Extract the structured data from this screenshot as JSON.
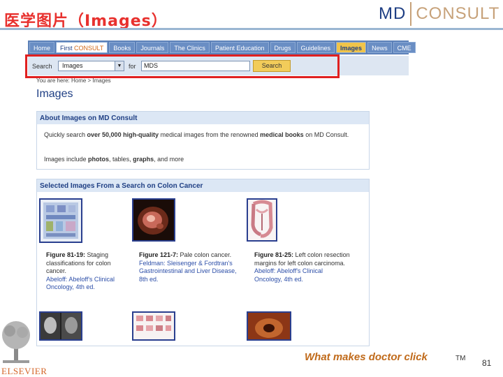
{
  "slide": {
    "title": "医学图片（Images）",
    "page_number": "81",
    "tagline": "What makes doctor click",
    "trademark": "TM"
  },
  "logo": {
    "md": "MD",
    "consult": "CONSULT"
  },
  "footer_logo": {
    "word": "ELSEVIER"
  },
  "nav": {
    "tabs": [
      {
        "label": "Home"
      },
      {
        "label_first": "First",
        "label_consult": "CONSULT"
      },
      {
        "label": "Books"
      },
      {
        "label": "Journals"
      },
      {
        "label": "The Clinics"
      },
      {
        "label": "Patient Education"
      },
      {
        "label": "Drugs"
      },
      {
        "label": "Guidelines"
      },
      {
        "label": "Images"
      },
      {
        "label": "News"
      },
      {
        "label": "CME"
      }
    ],
    "active_index": 8
  },
  "search": {
    "label": "Search",
    "category": "Images",
    "for_label": "for",
    "query": "MDS",
    "button": "Search"
  },
  "breadcrumb": "You are here: Home > Images",
  "page_heading": "Images",
  "about": {
    "title": "About Images on MD Consult",
    "line1_pre": "Quickly search ",
    "line1_bold": "over 50,000 high-quality",
    "line1_post": " medical images from the renowned ",
    "line1_bold2": "medical books",
    "line1_end": " on MD Consult.",
    "line2_pre": "Images include ",
    "line2_b1": "photos",
    "line2_mid": ", tables, ",
    "line2_b2": "graphs",
    "line2_end": ", and more"
  },
  "selected": {
    "title": "Selected Images From a Search on Colon Cancer",
    "figures": [
      {
        "fig": "Figure 81-19:",
        "text": " Staging classifications for colon cancer.",
        "link": "Abeloff: Abeloff's Clinical Oncology, 4th ed."
      },
      {
        "fig": "Figure 121-7:",
        "text": " Pale colon cancer.",
        "link": "Feldman: Sleisenger & Fordtran's Gastrointestinal and Liver Disease, 8th ed."
      },
      {
        "fig": "Figure 81-25:",
        "text": " Left colon resection margins for left colon carcinoma.",
        "link": "Abeloff: Abeloff's Clinical Oncology, 4th ed."
      }
    ]
  },
  "colors": {
    "title_red": "#e8312e",
    "nav_blue": "#5b80b8",
    "active_tab": "#f0c44a",
    "highlight_red": "#e02020",
    "tagline_orange": "#c06a1a"
  }
}
